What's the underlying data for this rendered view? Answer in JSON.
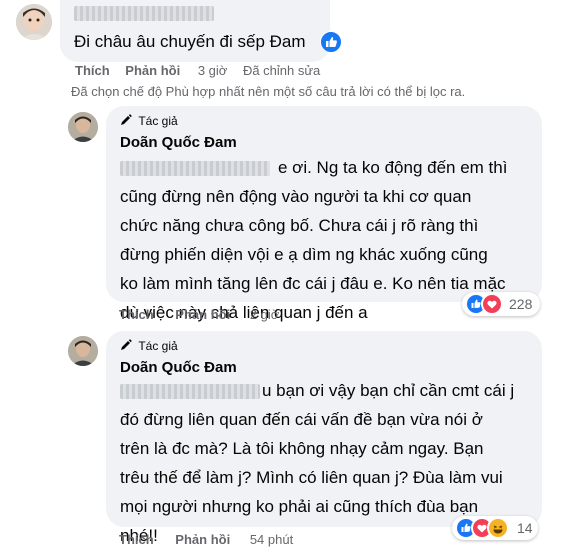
{
  "comments": [
    {
      "text": "Đi châu âu chuyến đi sếp Đam",
      "actions": {
        "like": "Thích",
        "reply": "Phản hồi",
        "time": "3 giờ",
        "edited": "Đã chỉnh sửa"
      }
    },
    {
      "badge": "Tác giả",
      "author": "Doãn Quốc Đam",
      "lines": [
        "e ơi. Ng ta ko động đến em thì",
        "cũng đừng nên động vào người ta khi cơ quan",
        "chức năng chưa công bố. Chưa cái j rõ ràng thì",
        "đừng phiến diện vội e ạ dìm ng khác xuống cũng",
        "ko làm mình tăng lên đc cái j đâu e. Ko nên tia mặc",
        "dù việc này chả liên quan j đến a"
      ],
      "reaction_count": "228",
      "actions": {
        "like": "Thích",
        "reply": "Phản hồi",
        "time": "2 giờ"
      }
    },
    {
      "badge": "Tác giả",
      "author": "Doãn Quốc Đam",
      "lines": [
        "u bạn ơi vậy bạn chỉ cần cmt cái j",
        "đó đừng liên quan đến cái vấn đề bạn vừa nói ở",
        "trên là đc mà? Là tôi không nhạy cảm ngay. Bạn",
        "trêu thế để làm j? Mình có liên quan j? Đùa làm vui",
        "mọi người nhưng ko phải ai cũng thích đùa bạn",
        "nhé!!"
      ],
      "reaction_count": "14",
      "actions": {
        "like": "Thích",
        "reply": "Phản hồi",
        "time": "54 phút"
      }
    }
  ],
  "filter_notice": "Đã chọn chế độ Phù hợp nhất nên một số câu trả lời có thể bị lọc ra.",
  "colors": {
    "like_blue": "#1877f2",
    "love_red": "#f33e58",
    "haha_yellow": "#f7b125",
    "bubble": "#f0f2f5",
    "meta": "#65676b"
  },
  "icons": [
    "like-icon",
    "love-icon",
    "haha-icon",
    "pen-icon"
  ]
}
